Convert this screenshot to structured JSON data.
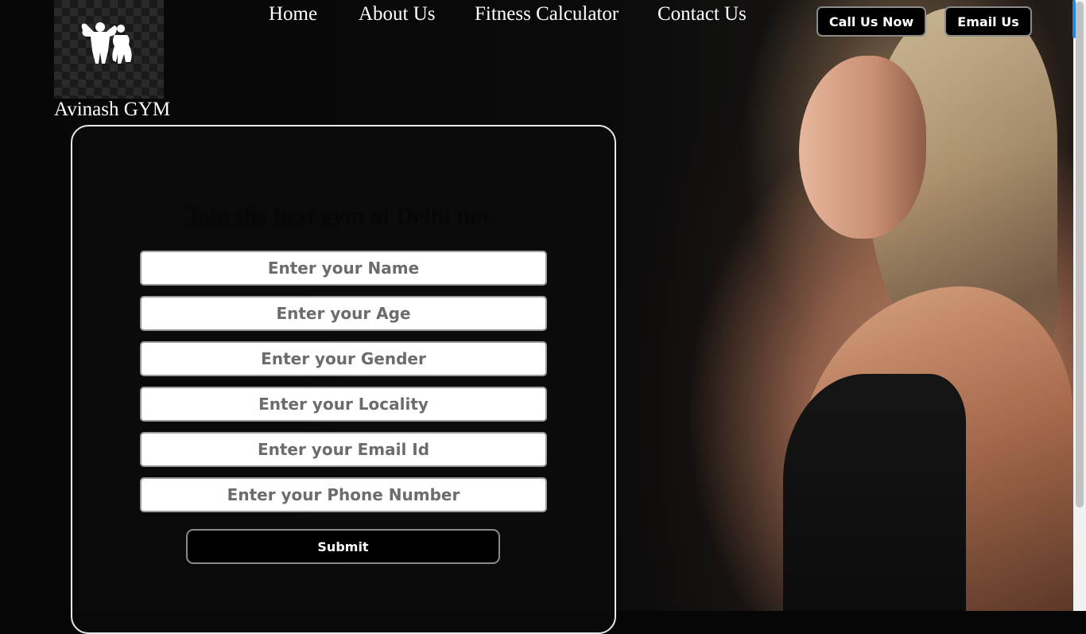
{
  "brand": {
    "name": "Avinash GYM",
    "logo_icon": "bodybuilder-couple-icon"
  },
  "nav": {
    "items": [
      "Home",
      "About Us",
      "Fitness Calculator",
      "Contact Us"
    ]
  },
  "actions": {
    "call_label": "Call Us Now",
    "email_label": "Email Us"
  },
  "form": {
    "title": "Join the best gym of Delhi now",
    "fields": [
      {
        "placeholder": "Enter your Name"
      },
      {
        "placeholder": "Enter your Age"
      },
      {
        "placeholder": "Enter your Gender"
      },
      {
        "placeholder": "Enter your Locality"
      },
      {
        "placeholder": "Enter your Email Id"
      },
      {
        "placeholder": "Enter your Phone Number"
      }
    ],
    "submit_label": "Submit"
  },
  "colors": {
    "background": "#050505",
    "accent": "#1e88e5",
    "button_bg": "#000000"
  }
}
